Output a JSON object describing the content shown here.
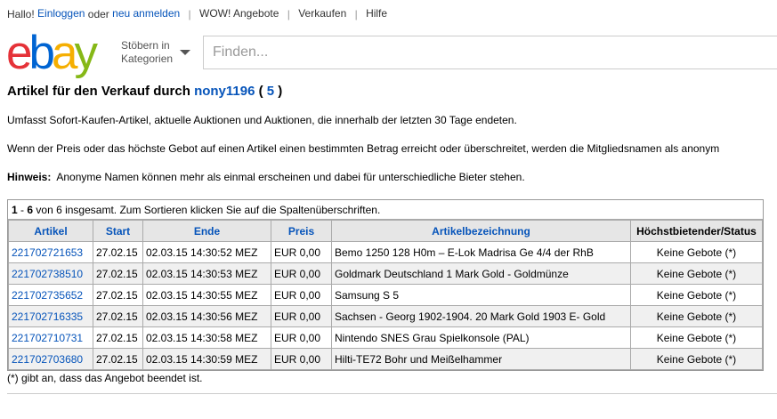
{
  "topbar": {
    "greeting": "Hallo!",
    "login": "Einloggen",
    "or": "oder",
    "register": "neu anmelden",
    "links": [
      "WOW! Angebote",
      "Verkaufen",
      "Hilfe"
    ]
  },
  "logo": {
    "e": "e",
    "b": "b",
    "a": "a",
    "y": "y"
  },
  "browse": {
    "line1": "Stöbern in",
    "line2": "Kategorien"
  },
  "search": {
    "placeholder": "Finden..."
  },
  "heading": {
    "prefix": "Artikel für den Verkauf durch",
    "seller": "nony1196",
    "open": "(",
    "count": "5",
    "close": ")"
  },
  "texts": {
    "p1": "Umfasst Sofort-Kaufen-Artikel, aktuelle Auktionen und Auktionen, die innerhalb der letzten 30 Tage endeten.",
    "p2": "Wenn der Preis oder das höchste Gebot auf einen Artikel einen bestimmten Betrag erreicht oder überschreitet, werden die Mitgliedsnamen als anonym",
    "hint_label": "Hinweis:",
    "hint_text": "Anonyme Namen können mehr als einmal erscheinen und dabei für unterschiedliche Bieter stehen."
  },
  "table": {
    "caption_range": "1",
    "caption_dash": "-",
    "caption_end": "6",
    "caption_rest": "von 6 insgesamt. Zum Sortieren klicken Sie auf die Spaltenüberschriften.",
    "headers": [
      "Artikel",
      "Start",
      "Ende",
      "Preis",
      "Artikelbezeichnung",
      "Höchstbietender/Status"
    ],
    "rows": [
      {
        "id": "221702721653",
        "start": "27.02.15",
        "end": "02.03.15 14:30:52 MEZ",
        "price": "EUR 0,00",
        "title": "Bemo 1250 128 H0m – E-Lok Madrisa Ge 4/4 der RhB",
        "status": "Keine Gebote (*)"
      },
      {
        "id": "221702738510",
        "start": "27.02.15",
        "end": "02.03.15 14:30:53 MEZ",
        "price": "EUR 0,00",
        "title": "Goldmark Deutschland 1 Mark Gold - Goldmünze",
        "status": "Keine Gebote (*)"
      },
      {
        "id": "221702735652",
        "start": "27.02.15",
        "end": "02.03.15 14:30:55 MEZ",
        "price": "EUR 0,00",
        "title": "Samsung S 5",
        "status": "Keine Gebote (*)"
      },
      {
        "id": "221702716335",
        "start": "27.02.15",
        "end": "02.03.15 14:30:56 MEZ",
        "price": "EUR 0,00",
        "title": "Sachsen - Georg 1902-1904. 20 Mark Gold 1903 E- Gold",
        "status": "Keine Gebote (*)"
      },
      {
        "id": "221702710731",
        "start": "27.02.15",
        "end": "02.03.15 14:30:58 MEZ",
        "price": "EUR 0,00",
        "title": "Nintendo SNES Grau Spielkonsole (PAL)",
        "status": "Keine Gebote (*)"
      },
      {
        "id": "221702703680",
        "start": "27.02.15",
        "end": "02.03.15 14:30:59 MEZ",
        "price": "EUR 0,00",
        "title": "Hilti-TE72 Bohr und Meißelhammer",
        "status": "Keine Gebote (*)"
      }
    ]
  },
  "footnote": "(*) gibt an, dass das Angebot beendet ist.",
  "colors": {
    "link": "#0654ba",
    "logo_e": "#e53238",
    "logo_b": "#0064d2",
    "logo_a": "#f5af02",
    "logo_y": "#86b817"
  }
}
